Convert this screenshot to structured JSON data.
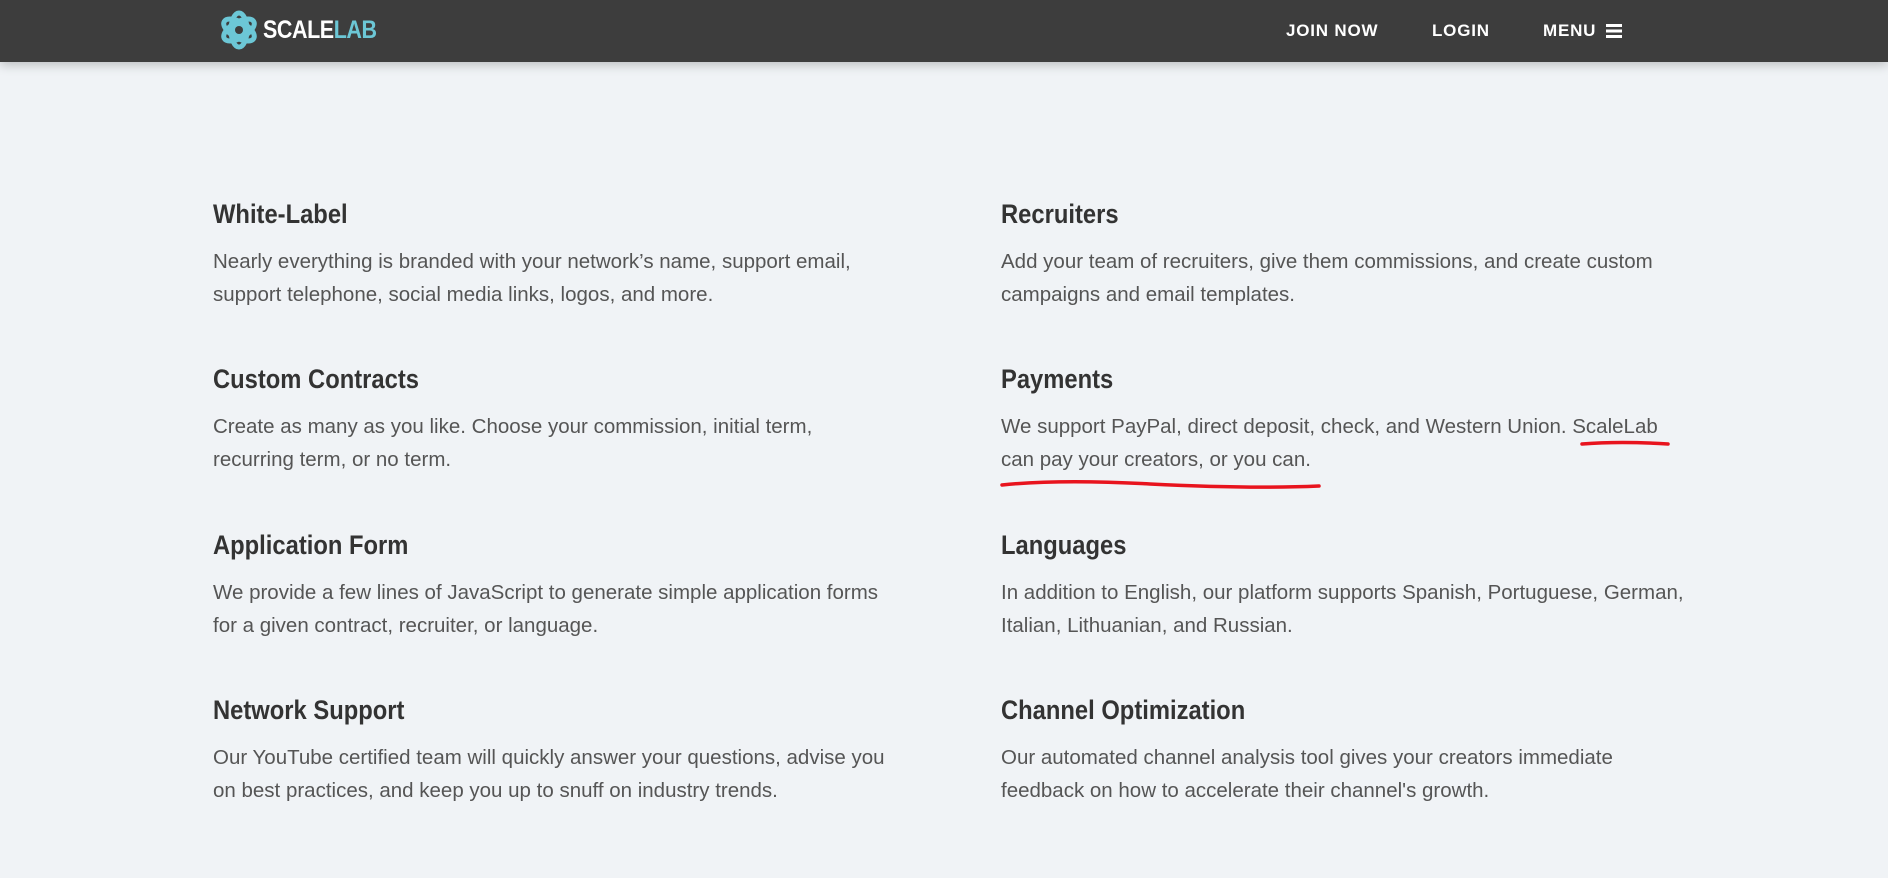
{
  "header": {
    "logo": {
      "part1": "SCALE",
      "part2": "LAB",
      "accent_color": "#6cc7d6"
    },
    "nav": {
      "join_label": "JOIN NOW",
      "login_label": "LOGIN",
      "menu_label": "MENU",
      "menu_icon": "hamburger-icon"
    },
    "background_color": "#3d3d3d"
  },
  "features": {
    "white_label": {
      "title": "White-Label",
      "text": "Nearly everything is branded with your network’s name, support email, support telephone, social media links, logos, and more."
    },
    "recruiters": {
      "title": "Recruiters",
      "text": "Add your team of recruiters, give them commissions, and create custom campaigns and email templates."
    },
    "custom_contracts": {
      "title": "Custom Contracts",
      "text": "Create as many as you like. Choose your commission, initial term, recurring term, or no term."
    },
    "payments": {
      "title": "Payments",
      "text": "We support PayPal, direct deposit, check, and Western Union. ScaleLab can pay your creators, or you can."
    },
    "application_form": {
      "title": "Application Form",
      "text": "We provide a few lines of JavaScript to generate simple application forms for a given contract, recruiter, or language."
    },
    "languages": {
      "title": "Languages",
      "text": "In addition to English, our platform supports Spanish, Portuguese, German, Italian, Lithuanian, and Russian."
    },
    "network_support": {
      "title": "Network Support",
      "text": "Our YouTube certified team will quickly answer your questions, advise you on best practices, and keep you up to snuff on industry trends."
    },
    "channel_optimization": {
      "title": "Channel Optimization",
      "text": "Our automated channel analysis tool gives your creators immediate feedback on how to accelerate their channel's growth."
    }
  },
  "annotation": {
    "color": "#e8141e"
  }
}
